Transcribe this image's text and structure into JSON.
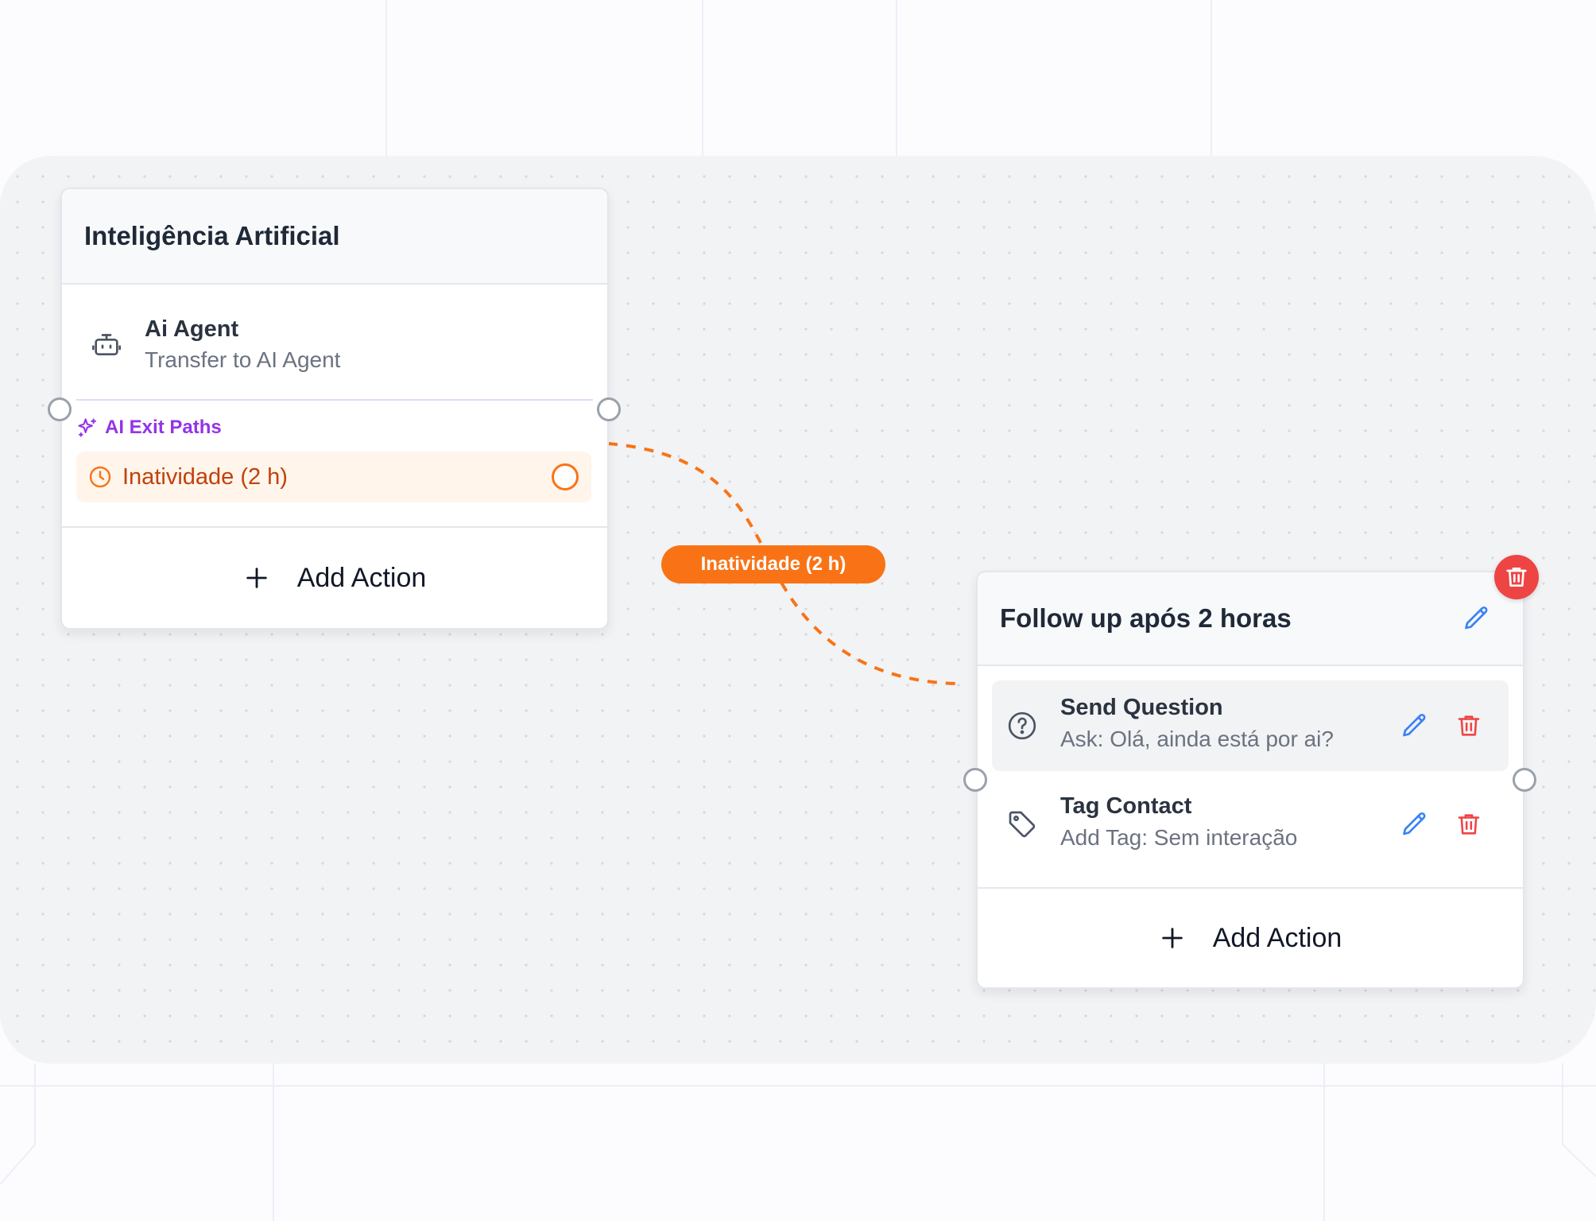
{
  "node_ai": {
    "title": "Inteligência Artificial",
    "action": {
      "icon": "bot-icon",
      "title": "Ai Agent",
      "subtitle": "Transfer to AI Agent"
    },
    "exit_paths": {
      "icon": "sparkles-icon",
      "label": "AI Exit Paths",
      "color": "#9333ea",
      "items": [
        {
          "icon": "clock-icon",
          "label": "Inatividade (2 h)",
          "color": "#c2410c"
        }
      ]
    },
    "add_action_label": "Add Action"
  },
  "edge": {
    "label": "Inatividade (2 h)",
    "color": "#f97316"
  },
  "node_followup": {
    "title": "Follow up após 2 horas",
    "actions": [
      {
        "icon": "question-circle-icon",
        "title": "Send Question",
        "subtitle": "Ask: Olá, ainda está por ai?"
      },
      {
        "icon": "tag-icon",
        "title": "Tag Contact",
        "subtitle": "Add Tag: Sem interação"
      }
    ],
    "add_action_label": "Add Action",
    "edit_color": "#3b82f6",
    "delete_color": "#ef4444"
  }
}
